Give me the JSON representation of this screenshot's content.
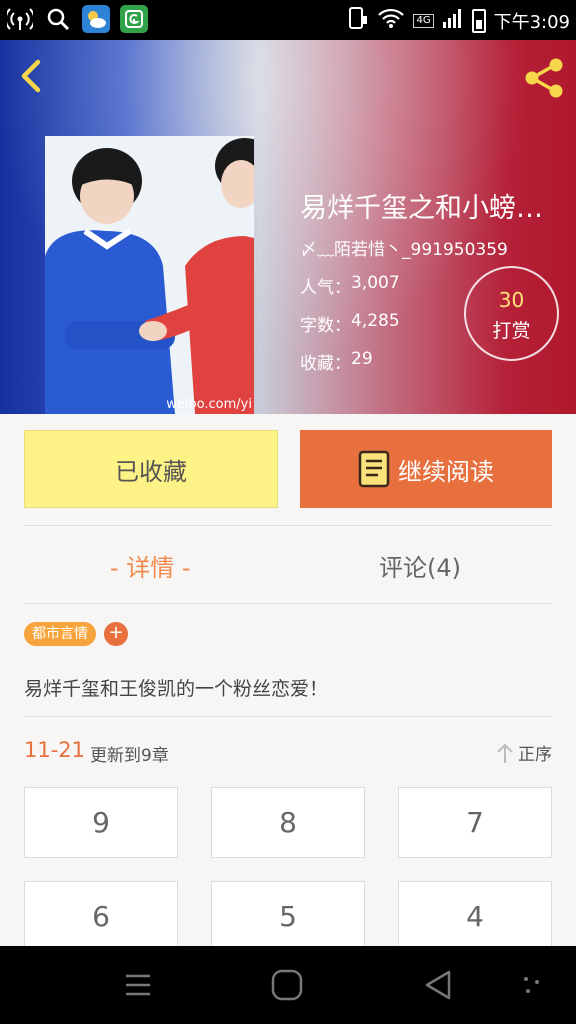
{
  "status_bar": {
    "network_label": "4G",
    "time": "下午3:09",
    "icons": [
      "signal-icon",
      "search-icon",
      "weather-app-icon",
      "security-app-icon",
      "sim-icon",
      "wifi-icon",
      "cell-signal-icon",
      "battery-icon"
    ]
  },
  "header": {
    "back_icon": "back-chevron-icon",
    "share_icon": "share-icon",
    "cover_watermark": "weibo.com/yi"
  },
  "book": {
    "title": "易烊千玺之和小螃…",
    "author": "〆﹏陌若惜丶_991950359",
    "popularity_label": "人气：",
    "popularity_value": "3,007",
    "words_label": "字数：",
    "words_value": "4,285",
    "favorites_label": "收藏：",
    "favorites_value": "29"
  },
  "reward": {
    "count": "30",
    "label": "打赏"
  },
  "actions": {
    "collected_label": "已收藏",
    "continue_label": "继续阅读"
  },
  "tabs": {
    "details_label": "- 详情 -",
    "comments_label": "评论(4)"
  },
  "tags": {
    "genre": "都市言情",
    "add": "+"
  },
  "summary": "易烊千玺和王俊凯的一个粉丝恋爱！",
  "update": {
    "date": "11-21",
    "text": "更新到9章",
    "sort_label": "正序"
  },
  "chapters": [
    "9",
    "8",
    "7",
    "6",
    "5",
    "4"
  ],
  "colors": {
    "accent_orange": "#e8703e",
    "collected_yellow": "#fdf285",
    "tag_orange": "#f6a43b",
    "reward_number": "#ffe27a"
  },
  "navbar": {
    "icons": [
      "menu-icon",
      "home-icon",
      "back-triangle-icon",
      "more-icon"
    ]
  }
}
